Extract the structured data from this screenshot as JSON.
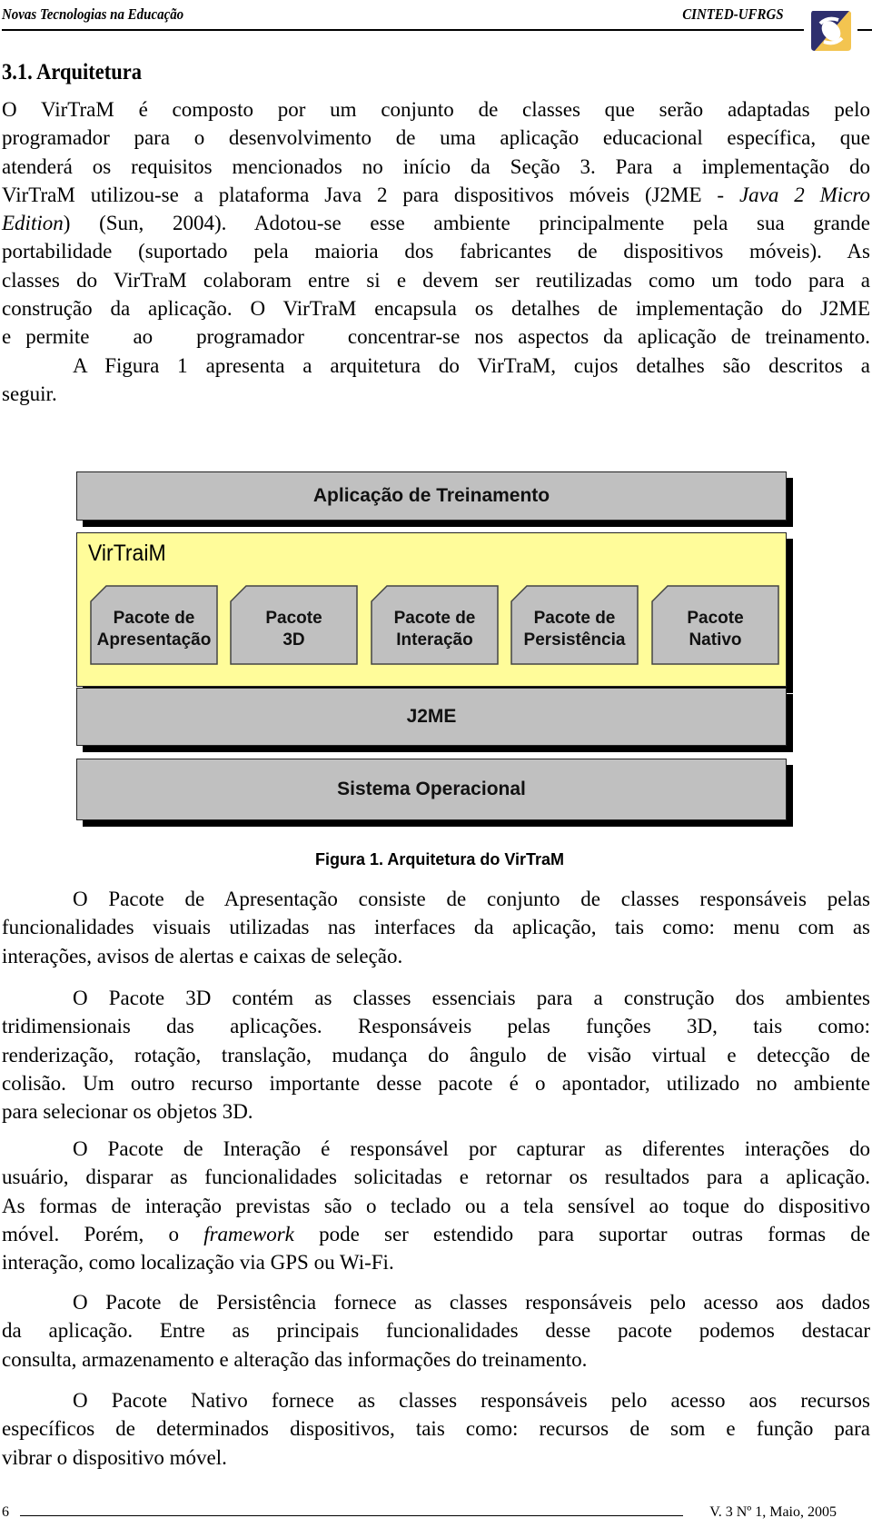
{
  "header": {
    "left": "Novas Tecnologias na Educação",
    "right": "CINTED-UFRGS",
    "logo_icon": "cinted-logo-icon",
    "logo_colors": {
      "dark": "#2e2f6e",
      "light": "#f3c450"
    }
  },
  "section_title": "3.1. Arquitetura",
  "intro": {
    "lines": [
      "O VirTraM é composto por um conjunto de classes que serão adaptadas pelo",
      "programador para o desenvolvimento de uma aplicação educacional específica, que",
      "atenderá os requisitos mencionados no início da Seção 3. Para a implementação do",
      "VirTraM utilizou-se a plataforma Java 2 para dispositivos móveis (J2ME - ",
      "Edition) (Sun, 2004). Adotou-se esse ambiente principalmente pela sua grande",
      "portabilidade (suportado pela maioria dos fabricantes de dispositivos móveis). As",
      "classes do VirTraM colaboram entre si e devem ser reutilizadas como um todo para a",
      "construção da aplicação. O VirTraM encapsula os detalhes de implementação do J2ME",
      "e permite   ao   programador   concentrar-se nos aspectos da aplicação de treinamento."
    ],
    "italic_1": "Java 2 Micro",
    "italic_2": "Edition",
    "line5_rest": ") (Sun, 2004). Adotou-se esse ambiente principalmente pela sua grande"
  },
  "figure_intro": {
    "line1": "A Figura 1 apresenta a arquitetura do VirTraM, cujos detalhes são descritos a",
    "line2": "seguir."
  },
  "diagram": {
    "top_layer": "Aplicação de Treinamento",
    "framework_title": "VirTraiM",
    "packages": [
      {
        "line1": "Pacote de",
        "line2": "Apresentação"
      },
      {
        "line1": "Pacote",
        "line2": "3D"
      },
      {
        "line1": "Pacote de",
        "line2": "Interação"
      },
      {
        "line1": "Pacote de",
        "line2": "Persistência"
      },
      {
        "line1": "Pacote",
        "line2": "Nativo"
      }
    ],
    "j2me_layer": "J2ME",
    "os_layer": "Sistema Operacional",
    "colors": {
      "layer_gray": "#c0c0c0",
      "framework_yellow": "#fffc9a",
      "shadow": "#000000"
    }
  },
  "caption": "Figura 1. Arquitetura do VirTraM",
  "paragraphs": {
    "apresentacao": [
      "O Pacote de Apresentação consiste de conjunto de classes responsáveis pelas",
      "funcionalidades visuais utilizadas nas interfaces da aplicação, tais como: menu com as",
      "interações, avisos de alertas e caixas de seleção."
    ],
    "pacote3d": [
      "O Pacote 3D contém as classes essenciais para a construção dos ambientes",
      "tridimensionais das aplicações. Responsáveis pelas funções 3D, tais como:",
      "renderização, rotação, translação, mudança do ângulo de visão virtual e detecção de",
      "colisão. Um outro recurso importante desse pacote é o apontador, utilizado no ambiente",
      "para selecionar os objetos 3D."
    ],
    "interacao": {
      "lines": [
        "O Pacote de Interação é responsável por capturar as diferentes interações do",
        "usuário, disparar as funcionalidades solicitadas e retornar os resultados para a aplicação.",
        "As formas de interação previstas são o teclado ou a tela sensível ao toque do dispositivo"
      ],
      "line4_pre": "móvel. Porém, o ",
      "line4_italic": "framework",
      "line4_post": " pode ser estendido para suportar outras formas de",
      "line5": "interação, como localização via GPS ou Wi-Fi."
    },
    "persistencia": [
      "O Pacote de Persistência fornece as classes responsáveis pelo acesso aos dados",
      "da aplicação. Entre as principais funcionalidades desse pacote podemos destacar",
      "consulta, armazenamento e alteração das informações do treinamento."
    ],
    "nativo": [
      "O Pacote Nativo fornece as classes responsáveis pelo acesso aos recursos",
      "específicos de determinados dispositivos, tais como: recursos de som e função para",
      "vibrar o dispositivo móvel."
    ]
  },
  "footer": {
    "page_number": "6",
    "issue": "V. 3 Nº 1, Maio, 2005"
  }
}
